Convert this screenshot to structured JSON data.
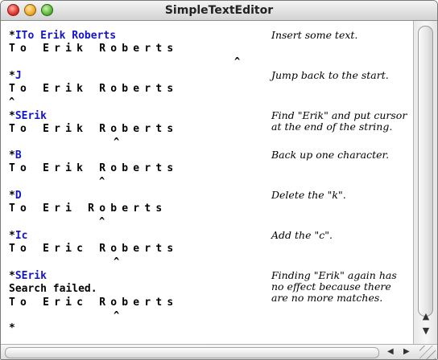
{
  "window": {
    "title": "SimpleTextEditor"
  },
  "steps": [
    {
      "command": "ITo Erik Roberts",
      "buffer": "To Erik Roberts",
      "note": "Insert some text.",
      "cursor_index": 15
    },
    {
      "command": "J",
      "buffer": "To Erik Roberts",
      "note": "Jump back to the start.",
      "cursor_index": 0
    },
    {
      "command": "SErik",
      "buffer": "To Erik Roberts",
      "note": "Find \"Erik\" and put cursor\nat the end of the string.",
      "cursor_index": 7
    },
    {
      "command": "B",
      "buffer": "To Erik Roberts",
      "note": "Back up one character.",
      "cursor_index": 6
    },
    {
      "command": "D",
      "buffer": "To Eri Roberts",
      "note": "Delete the \"k\".",
      "cursor_index": 6
    },
    {
      "command": "Ic",
      "buffer": "To Eric Roberts",
      "note": "Add the \"c\".",
      "cursor_index": 7
    },
    {
      "command": "SErik",
      "message": "Search failed.",
      "buffer": "To Eric Roberts",
      "note": "Finding \"Erik\" again has\nno effect because there\nare no more matches.",
      "cursor_index": 7
    }
  ],
  "prompt": "*",
  "caret_glyph": "^",
  "prompt_star": "*"
}
